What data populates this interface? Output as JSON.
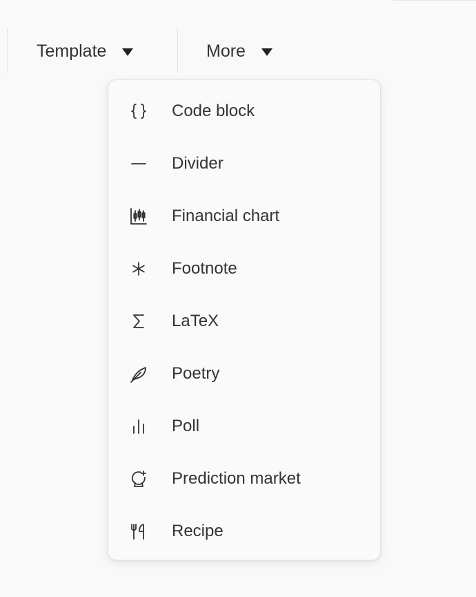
{
  "toolbar": {
    "template_label": "Template",
    "more_label": "More"
  },
  "menu": {
    "items": [
      {
        "label": "Code block",
        "icon": "code-braces-icon"
      },
      {
        "label": "Divider",
        "icon": "divider-icon"
      },
      {
        "label": "Financial chart",
        "icon": "candlestick-chart-icon"
      },
      {
        "label": "Footnote",
        "icon": "asterisk-icon"
      },
      {
        "label": "LaTeX",
        "icon": "sigma-icon"
      },
      {
        "label": "Poetry",
        "icon": "feather-icon"
      },
      {
        "label": "Poll",
        "icon": "bar-chart-icon"
      },
      {
        "label": "Prediction market",
        "icon": "crystal-ball-icon"
      },
      {
        "label": "Recipe",
        "icon": "utensils-icon"
      }
    ]
  }
}
